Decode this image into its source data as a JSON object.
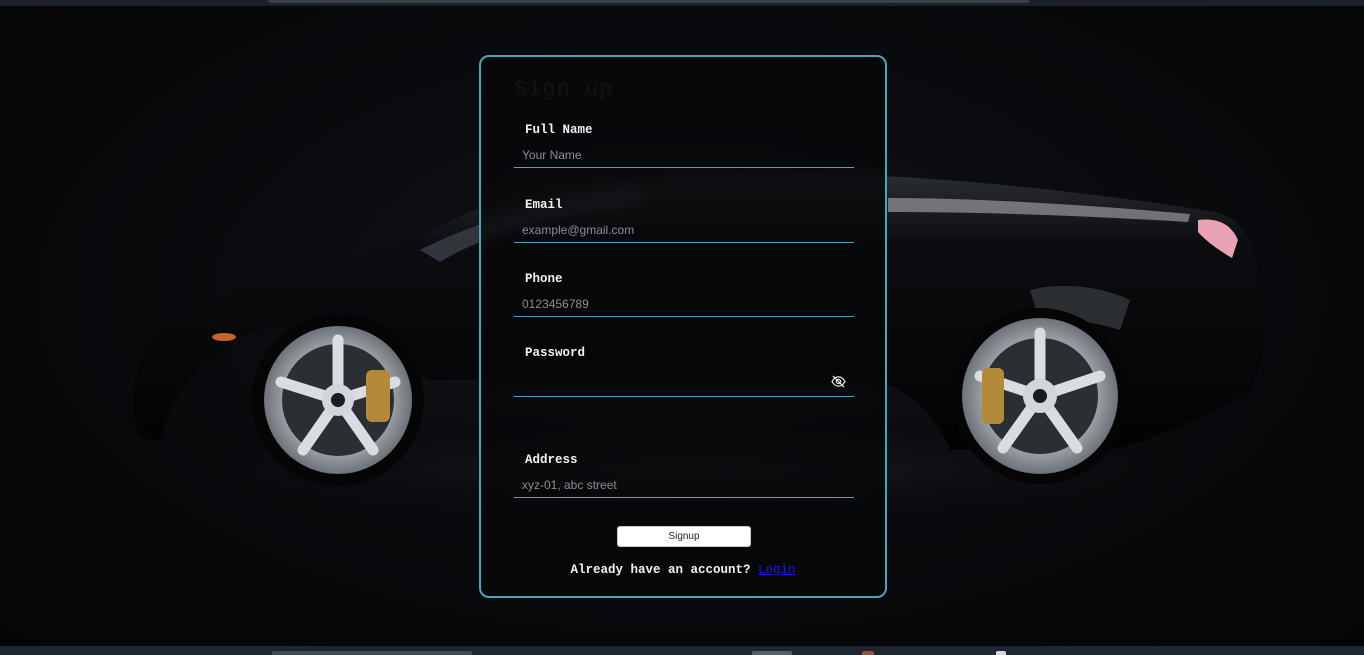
{
  "form": {
    "title": "Sign up",
    "fields": {
      "full_name": {
        "label": "Full Name",
        "placeholder": "Your Name",
        "value": ""
      },
      "email": {
        "label": "Email",
        "placeholder": "example@gmail.com",
        "value": ""
      },
      "phone": {
        "label": "Phone",
        "placeholder": "0123456789",
        "value": ""
      },
      "password": {
        "label": "Password",
        "placeholder": "",
        "value": "",
        "toggle_icon": "eye-slash-icon"
      },
      "address": {
        "label": "Address",
        "placeholder": "xyz-01, abc street",
        "value": ""
      }
    },
    "submit_label": "Signup",
    "login_prompt": "Already have an account?",
    "login_link": "Login"
  },
  "colors": {
    "accent": "#49a6b8",
    "link": "#1a1adb",
    "background": "#050608"
  }
}
